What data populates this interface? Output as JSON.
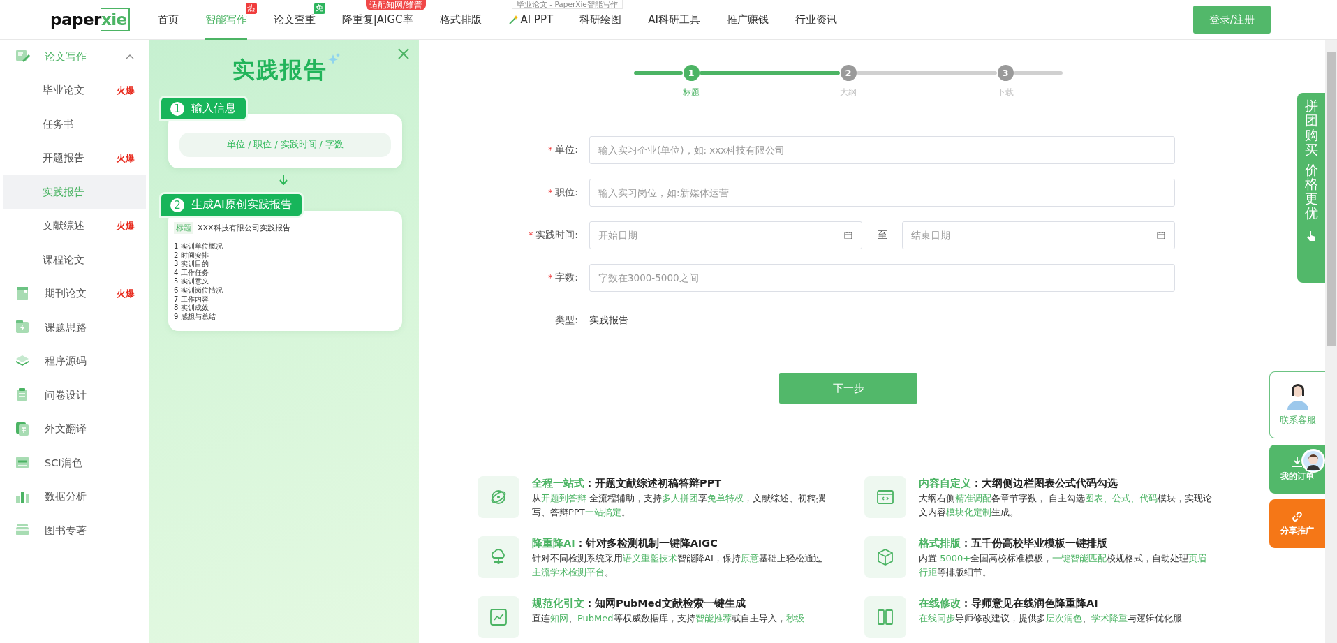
{
  "tooltip": {
    "title": "毕业论文 - PaperXie智能写作"
  },
  "nav": {
    "logo": {
      "word": "paper",
      "highlight": "xie"
    },
    "items": [
      {
        "label": "首页",
        "selected": false
      },
      {
        "label": "智能写作",
        "selected": true,
        "badge": {
          "text": "热",
          "color": "#f03c3c"
        }
      },
      {
        "label": "论文查重",
        "selected": false,
        "badge": {
          "text": "免",
          "color": "#2db55d"
        }
      },
      {
        "label": "降重复|AIGC率",
        "selected": false,
        "banner": "适配知网/维普"
      },
      {
        "label": "格式排版",
        "selected": false
      },
      {
        "label": "AI PPT",
        "selected": false,
        "kind": "wand"
      },
      {
        "label": "科研绘图",
        "selected": false
      },
      {
        "label": "AI科研工具",
        "selected": false
      },
      {
        "label": "推广赚钱",
        "selected": false
      },
      {
        "label": "行业资讯",
        "selected": false
      }
    ],
    "login": "登录/注册"
  },
  "sidebar": {
    "groups": [
      {
        "label": "论文写作",
        "selected": true,
        "expanded": true,
        "children": [
          {
            "label": "毕业论文",
            "selected": false,
            "tag": "火爆"
          },
          {
            "label": "任务书",
            "selected": false
          },
          {
            "label": "开题报告",
            "selected": false,
            "tag": "火爆"
          },
          {
            "label": "实践报告",
            "selected": true
          },
          {
            "label": "文献综述",
            "selected": false,
            "tag": "火爆"
          },
          {
            "label": "课程论文",
            "selected": false
          }
        ]
      },
      {
        "label": "期刊论文",
        "selected": false,
        "tag": "火爆"
      },
      {
        "label": "课题思路",
        "selected": false
      },
      {
        "label": "程序源码",
        "selected": false
      },
      {
        "label": "问卷设计",
        "selected": false
      },
      {
        "label": "外文翻译",
        "selected": false
      },
      {
        "label": "SCI润色",
        "selected": false
      },
      {
        "label": "数据分析",
        "selected": false
      },
      {
        "label": "图书专著",
        "selected": false
      }
    ]
  },
  "panel": {
    "title": "实践报告",
    "steps": [
      {
        "number": "1",
        "label": "输入信息"
      },
      {
        "number": "2",
        "label": "生成AI原创实践报告"
      }
    ],
    "fields_hint": "单位 / 职位 / 实践时间 / 字数",
    "preview": {
      "tag": "标题",
      "title": "XXX科技有限公司实践报告",
      "outline": [
        "1 实训单位概况",
        "2 时间安排",
        "3 实训目的",
        "4 工作任务",
        "5 实训意义",
        "6 实训岗位情况",
        "7 工作内容",
        "8 实训成效",
        "9 感想与总结"
      ]
    }
  },
  "stepper": [
    {
      "number": "1",
      "label": "标题",
      "selected": true
    },
    {
      "number": "2",
      "label": "大纲",
      "selected": false
    },
    {
      "number": "3",
      "label": "下载",
      "selected": false
    }
  ],
  "form": {
    "required_mark": "*",
    "fields": [
      {
        "kind": "text",
        "label": "单位:",
        "required": true,
        "placeholder": "输入实习企业(单位)，如: xxx科技有限公司"
      },
      {
        "kind": "text",
        "label": "职位:",
        "required": true,
        "placeholder": "输入实习岗位，如:新媒体运营"
      },
      {
        "kind": "date_range",
        "label": "实践时间:",
        "required": true,
        "start_placeholder": "开始日期",
        "separator": "至",
        "end_placeholder": "结束日期"
      },
      {
        "kind": "text",
        "label": "字数:",
        "required": true,
        "placeholder": "字数在3000-5000之间"
      },
      {
        "kind": "static",
        "label": "类型:",
        "required": false,
        "value": "实践报告"
      }
    ],
    "next_button": "下一步"
  },
  "features": [
    {
      "title": [
        {
          "text": "全程一站式",
          "highlight": true
        },
        {
          "text": "：开题文献综述初稿答辩PPT",
          "highlight": false
        }
      ],
      "description": [
        {
          "text": "从",
          "highlight": false
        },
        {
          "text": "开题到答辩",
          "highlight": true
        },
        {
          "text": " 全流程辅助，支持",
          "highlight": false
        },
        {
          "text": "多人拼团",
          "highlight": true
        },
        {
          "text": "享",
          "highlight": false
        },
        {
          "text": "免单特权",
          "highlight": true
        },
        {
          "text": "，文献综述、初稿撰写、答辩PPT",
          "highlight": false
        },
        {
          "text": "一站搞定",
          "highlight": true
        },
        {
          "text": "。",
          "highlight": false
        }
      ]
    },
    {
      "title": [
        {
          "text": "内容自定义",
          "highlight": true
        },
        {
          "text": "：大纲侧边栏图表公式代码勾选",
          "highlight": false
        }
      ],
      "description": [
        {
          "text": "大纲右侧",
          "highlight": false
        },
        {
          "text": "精准调配",
          "highlight": true
        },
        {
          "text": "各章节字数， 自主勾选",
          "highlight": false
        },
        {
          "text": "图表、公式、代码",
          "highlight": true
        },
        {
          "text": "模块，实现论文内容",
          "highlight": false
        },
        {
          "text": "模块化定制",
          "highlight": true
        },
        {
          "text": "生成。",
          "highlight": false
        }
      ]
    },
    {
      "title": [
        {
          "text": "降重降AI",
          "highlight": true
        },
        {
          "text": "：针对多检测机制一键降AIGC",
          "highlight": false
        }
      ],
      "description": [
        {
          "text": "针对不同检测系统采用",
          "highlight": false
        },
        {
          "text": "语义重塑技术",
          "highlight": true
        },
        {
          "text": "智能降AI，保持",
          "highlight": false
        },
        {
          "text": "原意",
          "highlight": true
        },
        {
          "text": "基础上轻松通过",
          "highlight": false
        },
        {
          "text": "主流学术检测平台",
          "highlight": true
        },
        {
          "text": "。",
          "highlight": false
        }
      ]
    },
    {
      "title": [
        {
          "text": "格式排版",
          "highlight": true
        },
        {
          "text": "：五千份高校毕业模板一键排版",
          "highlight": false
        }
      ],
      "description": [
        {
          "text": "内置 ",
          "highlight": false
        },
        {
          "text": "5000+",
          "highlight": true
        },
        {
          "text": "全国高校标准模板，",
          "highlight": false
        },
        {
          "text": "一键智能匹配",
          "highlight": true
        },
        {
          "text": "校规格式，自动处理",
          "highlight": false
        },
        {
          "text": "页眉行距",
          "highlight": true
        },
        {
          "text": "等排版细节。",
          "highlight": false
        }
      ]
    },
    {
      "title": [
        {
          "text": "规范化引文",
          "highlight": true
        },
        {
          "text": "：知网PubMed文献检索一键生成",
          "highlight": false
        }
      ],
      "description": [
        {
          "text": "直连",
          "highlight": false
        },
        {
          "text": "知网",
          "highlight": true
        },
        {
          "text": "、",
          "highlight": false
        },
        {
          "text": "PubMed",
          "highlight": true
        },
        {
          "text": "等权威数据库，支持",
          "highlight": false
        },
        {
          "text": "智能推荐",
          "highlight": true
        },
        {
          "text": "或自主导入，",
          "highlight": false
        },
        {
          "text": "秒级",
          "highlight": true
        }
      ]
    },
    {
      "title": [
        {
          "text": "在线修改",
          "highlight": true
        },
        {
          "text": "：导师意见在线润色降重降AI",
          "highlight": false
        }
      ],
      "description": [
        {
          "text": "在线同步",
          "highlight": true
        },
        {
          "text": "导师修改建议，提供多",
          "highlight": false
        },
        {
          "text": "层次润色",
          "highlight": true
        },
        {
          "text": "、",
          "highlight": false
        },
        {
          "text": "学术降重",
          "highlight": true
        },
        {
          "text": "与逻辑优化服",
          "highlight": false
        }
      ]
    }
  ],
  "floats": {
    "group_buy": [
      "拼团购买",
      "价格更优"
    ],
    "contact": "联系客服",
    "orders": "我的订单",
    "share": "分享推广"
  }
}
